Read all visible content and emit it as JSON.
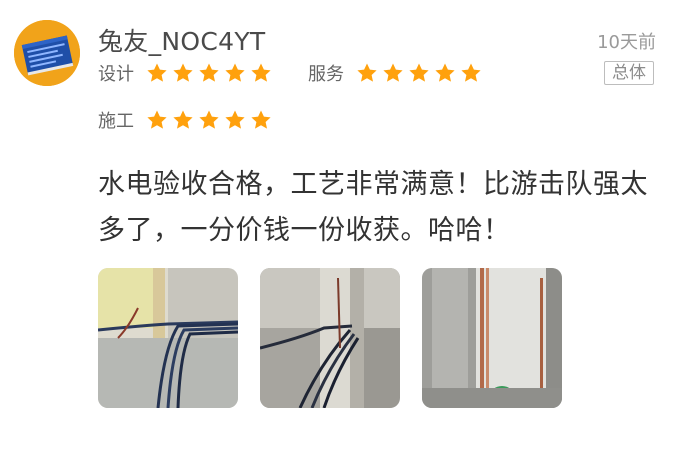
{
  "review": {
    "username": "兔友_NOC4YT",
    "time": "10天前",
    "badge": "总体",
    "ratings": [
      {
        "label": "设计",
        "stars": 5
      },
      {
        "label": "服务",
        "stars": 5
      },
      {
        "label": "施工",
        "stars": 5
      }
    ],
    "content": "水电验收合格，工艺非常满意！比游击队强太多了，一分价钱一份收获。哈哈！",
    "photos": [
      {
        "icon": "construction-photo-wiring-floor"
      },
      {
        "icon": "construction-photo-wiring-corner"
      },
      {
        "icon": "construction-photo-pipes-wall"
      }
    ]
  },
  "colors": {
    "star": "#ffa10d",
    "avatar_bg": "#f1a31a",
    "text_primary": "#333333",
    "text_secondary": "#9a9a9a"
  }
}
